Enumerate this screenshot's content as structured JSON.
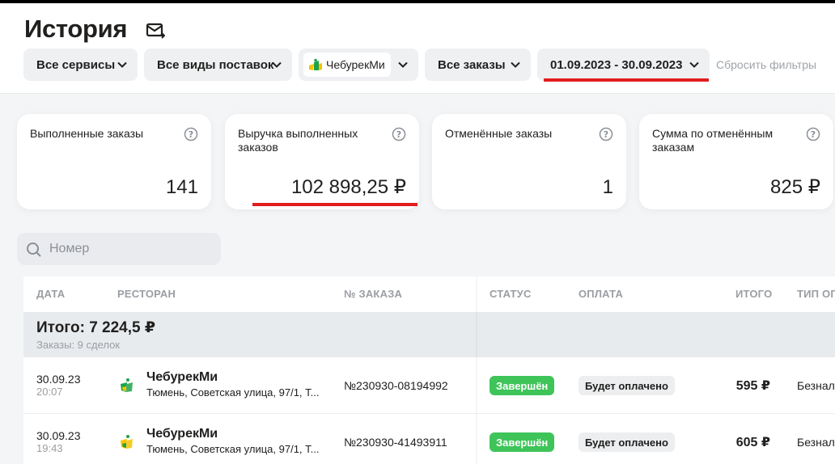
{
  "page": {
    "title": "История"
  },
  "filters": {
    "services": "Все сервисы",
    "supply": "Все виды поставок",
    "restaurant": "ЧебурекМи",
    "orders": "Все заказы",
    "date_range": "01.09.2023 - 30.09.2023",
    "reset": "Сбросить фильтры"
  },
  "cards": [
    {
      "label": "Выполненные заказы",
      "value": "141"
    },
    {
      "label": "Выручка выполненных заказов",
      "value": "102 898,25 ₽"
    },
    {
      "label": "Отменённые заказы",
      "value": "1"
    },
    {
      "label": "Сумма по отменённым заказам",
      "value": "825 ₽"
    }
  ],
  "search": {
    "placeholder": "Номер"
  },
  "table": {
    "headers": {
      "date": "Дата",
      "restaurant": "Ресторан",
      "order": "№ заказа",
      "status": "Статус",
      "payment": "Оплата",
      "total": "Итого",
      "payment_type": "Тип оп"
    },
    "summary": {
      "title": "Итого: 7 224,5 ₽",
      "subtitle": "Заказы: 9 сделок"
    },
    "rows": [
      {
        "date": "30.09.23",
        "time": "20:07",
        "restaurant": "ЧебурекМи",
        "address": "Тюмень, Советская улица, 97/1, Т...",
        "order": "№230930-08194992",
        "status": "Завершён",
        "payment": "Будет оплачено",
        "total": "595 ₽",
        "payment_type": "Безнал"
      },
      {
        "date": "30.09.23",
        "time": "19:43",
        "restaurant": "ЧебурекМи",
        "address": "Тюмень, Советская улица, 97/1, Т...",
        "order": "№230930-41493911",
        "status": "Завершён",
        "payment": "Будет оплачено",
        "total": "605 ₽",
        "payment_type": "Безнал"
      }
    ]
  },
  "colors": {
    "status_done": "#3fc45a",
    "highlight_underline": "#e31d1d",
    "logo_green": "#1fa34a",
    "logo_yellow": "#f5c400"
  }
}
